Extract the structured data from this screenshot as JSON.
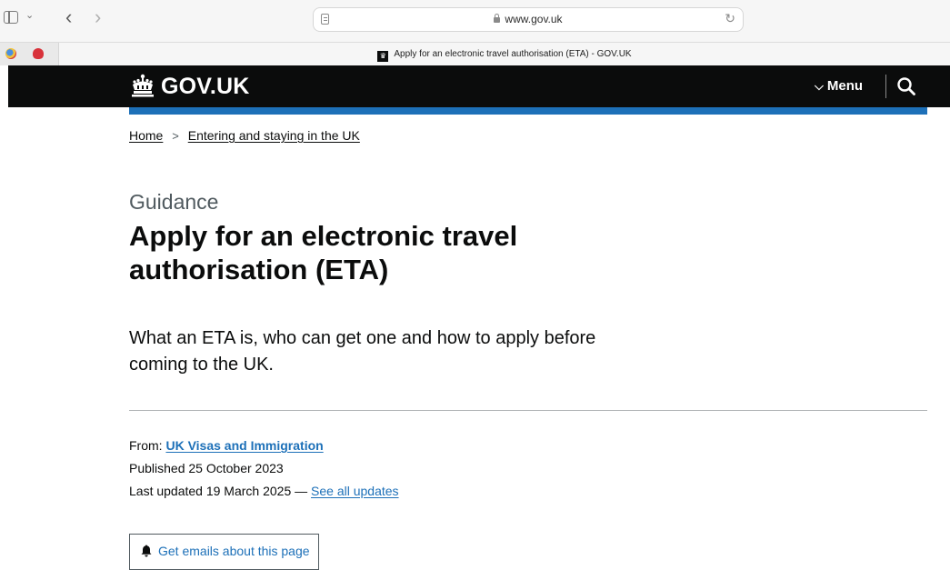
{
  "browser": {
    "url": "www.gov.uk",
    "tab_title": "Apply for an electronic travel authorisation (ETA) - GOV.UK"
  },
  "header": {
    "logo_text": "GOV.UK",
    "menu_label": "Menu"
  },
  "breadcrumb": {
    "items": [
      "Home",
      "Entering and staying in the UK"
    ],
    "separator": ">"
  },
  "page": {
    "caption": "Guidance",
    "title": "Apply for an electronic travel authorisation (ETA)",
    "lead": "What an ETA is, who can get one and how to apply before coming to the UK."
  },
  "metadata": {
    "from_label": "From:",
    "from_org": "UK Visas and Immigration",
    "published": "Published 25 October 2023",
    "last_updated": "Last updated 19 March 2025 —",
    "see_all_updates": "See all updates"
  },
  "actions": {
    "email_button": "Get emails about this page"
  },
  "colors": {
    "header_bg": "#0b0c0c",
    "brand_blue": "#1d70b8",
    "link": "#1d70b8",
    "secondary_text": "#505a5f"
  }
}
